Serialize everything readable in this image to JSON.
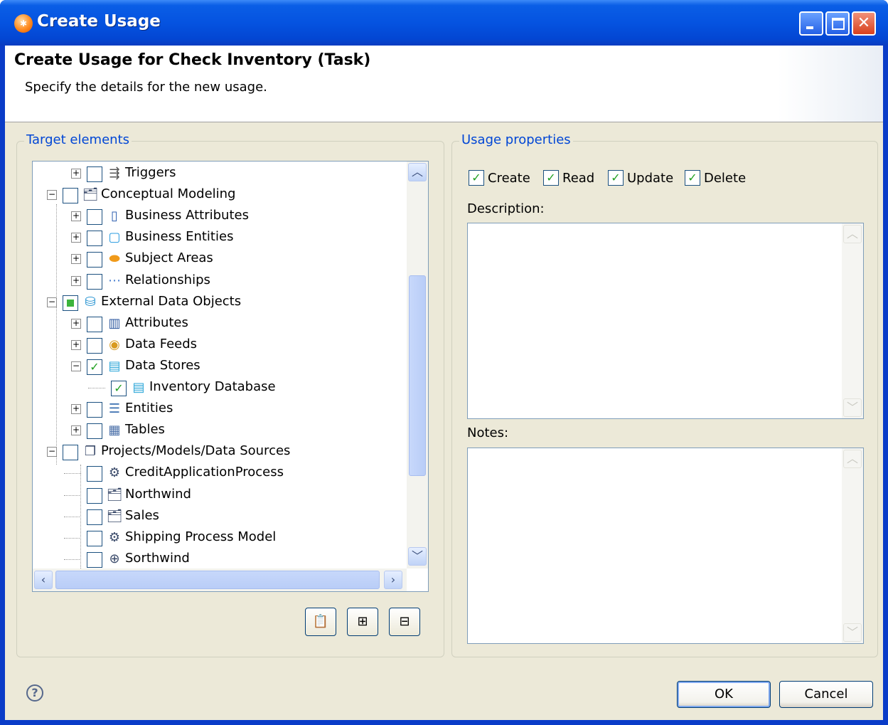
{
  "window": {
    "title": "Create Usage",
    "icon": "app-logo-icon"
  },
  "header": {
    "title": "Create Usage for Check Inventory (Task)",
    "subtitle": "Specify the details for the new usage."
  },
  "target": {
    "legend": "Target elements",
    "tree": [
      {
        "label": "Triggers",
        "icon": "trigger-icon",
        "level": 1,
        "expander": "+",
        "checked": false
      },
      {
        "label": "Conceptual Modeling",
        "icon": "model-icon",
        "level": 0,
        "expander": "-",
        "checked": false
      },
      {
        "label": "Business Attributes",
        "icon": "business-attribute-icon",
        "level": 1,
        "expander": "+",
        "checked": false
      },
      {
        "label": "Business Entities",
        "icon": "business-entity-icon",
        "level": 1,
        "expander": "+",
        "checked": false
      },
      {
        "label": "Subject Areas",
        "icon": "subject-area-icon",
        "level": 1,
        "expander": "+",
        "checked": false
      },
      {
        "label": "Relationships",
        "icon": "relationship-icon",
        "level": 1,
        "expander": "+",
        "checked": false
      },
      {
        "label": "External Data Objects",
        "icon": "external-data-icon",
        "level": 0,
        "expander": "-",
        "checked": "partial"
      },
      {
        "label": "Attributes",
        "icon": "attribute-icon",
        "level": 1,
        "expander": "+",
        "checked": false
      },
      {
        "label": "Data Feeds",
        "icon": "data-feed-icon",
        "level": 1,
        "expander": "+",
        "checked": false
      },
      {
        "label": "Data Stores",
        "icon": "data-store-icon",
        "level": 1,
        "expander": "-",
        "checked": true
      },
      {
        "label": "Inventory Database",
        "icon": "database-icon",
        "level": 2,
        "expander": "",
        "checked": true
      },
      {
        "label": "Entities",
        "icon": "entity-icon",
        "level": 1,
        "expander": "+",
        "checked": false
      },
      {
        "label": "Tables",
        "icon": "table-icon",
        "level": 1,
        "expander": "+",
        "checked": false
      },
      {
        "label": "Projects/Models/Data Sources",
        "icon": "projects-icon",
        "level": 0,
        "expander": "-",
        "checked": false
      },
      {
        "label": "CreditApplicationProcess",
        "icon": "process-model-icon",
        "level": 1,
        "expander": "",
        "checked": false
      },
      {
        "label": "Northwind",
        "icon": "model-icon",
        "level": 1,
        "expander": "",
        "checked": false
      },
      {
        "label": "Sales",
        "icon": "model-icon",
        "level": 1,
        "expander": "",
        "checked": false
      },
      {
        "label": "Shipping Process Model",
        "icon": "process-model-icon",
        "level": 1,
        "expander": "",
        "checked": false
      },
      {
        "label": "Sorthwind",
        "icon": "data-source-icon",
        "level": 1,
        "expander": "",
        "checked": false
      }
    ],
    "tools": [
      {
        "name": "select-all-button",
        "icon": "clipboard-check-icon"
      },
      {
        "name": "expand-all-button",
        "icon": "expand-all-icon"
      },
      {
        "name": "collapse-all-button",
        "icon": "collapse-all-icon"
      }
    ]
  },
  "properties": {
    "legend": "Usage properties",
    "checks": [
      {
        "label": "Create",
        "checked": true
      },
      {
        "label": "Read",
        "checked": true
      },
      {
        "label": "Update",
        "checked": true
      },
      {
        "label": "Delete",
        "checked": true
      }
    ],
    "description_label": "Description:",
    "description_value": "",
    "notes_label": "Notes:",
    "notes_value": ""
  },
  "footer": {
    "ok_label": "OK",
    "cancel_label": "Cancel"
  },
  "colors": {
    "titlebar": "#0553e0",
    "dialog_bg": "#ece9d8",
    "legend": "#0046d5",
    "check": "#21a121"
  }
}
